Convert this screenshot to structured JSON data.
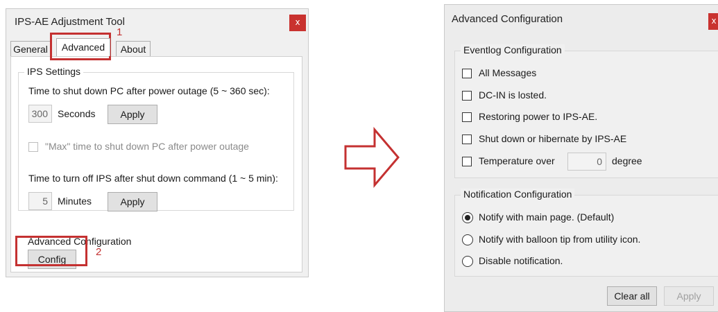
{
  "left_window": {
    "title": "IPS-AE Adjustment Tool",
    "close_glyph": "x",
    "tabs": [
      {
        "label": "General"
      },
      {
        "label": "Advanced"
      },
      {
        "label": "About"
      }
    ],
    "ips_settings": {
      "group_title": "IPS Settings",
      "shutdown_pc_label": "Time to shut down PC after power outage (5 ~ 360 sec):",
      "shutdown_pc_value": "300",
      "shutdown_pc_unit": "Seconds",
      "shutdown_pc_apply": "Apply",
      "max_checkbox_label": "\"Max\" time to shut down PC after power outage",
      "turn_off_ips_label": "Time to turn off IPS after shut down command (1 ~ 5 min):",
      "turn_off_ips_value": "5",
      "turn_off_ips_unit": "Minutes",
      "turn_off_ips_apply": "Apply"
    },
    "advanced_config_label": "Advanced Configuration",
    "config_button": "Config"
  },
  "annotations": {
    "step1": "1",
    "step2": "2",
    "highlight_color": "#c43131"
  },
  "arrow": {
    "icon": "right-arrow-outline-icon",
    "color": "#c43131"
  },
  "right_window": {
    "title": "Advanced Configuration",
    "close_glyph": "x",
    "eventlog": {
      "group_title": "Eventlog Configuration",
      "items": [
        {
          "label": "All Messages",
          "checked": false
        },
        {
          "label": "DC-IN is losted.",
          "checked": false
        },
        {
          "label": "Restoring power to IPS-AE.",
          "checked": false
        },
        {
          "label": "Shut down or hibernate by IPS-AE",
          "checked": false
        },
        {
          "label": "Temperature over",
          "checked": false
        }
      ],
      "temperature_value": "0",
      "temperature_unit": "degree"
    },
    "notification": {
      "group_title": "Notification Configuration",
      "options": [
        {
          "label": "Notify with main page. (Default)",
          "selected": true
        },
        {
          "label": "Notify with balloon tip from utility icon.",
          "selected": false
        },
        {
          "label": "Disable notification.",
          "selected": false
        }
      ]
    },
    "clear_all_button": "Clear all",
    "apply_button": "Apply"
  }
}
